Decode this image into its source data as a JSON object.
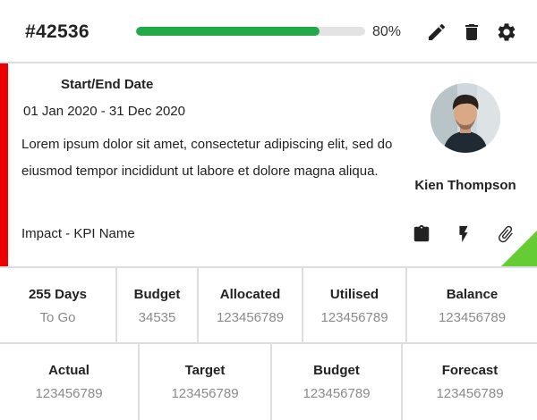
{
  "header": {
    "ticket_id": "#42536",
    "progress": {
      "value": 0.8,
      "label": "80%",
      "color": "#22a94a"
    },
    "icons": [
      "edit-icon",
      "delete-icon",
      "settings-icon"
    ]
  },
  "body": {
    "accent_color": "#ee0000",
    "date_label": "Start/End Date",
    "date_range": "01 Jan 2020 - 31 Dec 2020",
    "description": "Lorem ipsum dolor sit amet, consectetur adipiscing elit, sed do eiusmod tempor incididunt ut labore et dolore magna aliqua.",
    "impact": "Impact - KPI Name",
    "person_name": "Kien Thompson",
    "action_icons": [
      "clipboard-icon",
      "lightning-icon",
      "paperclip-icon"
    ],
    "corner_color": "#66cc33"
  },
  "stats_row_1": [
    {
      "title": "255 Days",
      "value": "To Go"
    },
    {
      "title": "Budget",
      "value": "34535"
    },
    {
      "title": "Allocated",
      "value": "123456789"
    },
    {
      "title": "Utilised",
      "value": "123456789"
    },
    {
      "title": "Balance",
      "value": "123456789"
    }
  ],
  "stats_row_2": [
    {
      "title": "Actual",
      "value": "123456789"
    },
    {
      "title": "Target",
      "value": "123456789"
    },
    {
      "title": "Budget",
      "value": "123456789"
    },
    {
      "title": "Forecast",
      "value": "123456789"
    }
  ]
}
